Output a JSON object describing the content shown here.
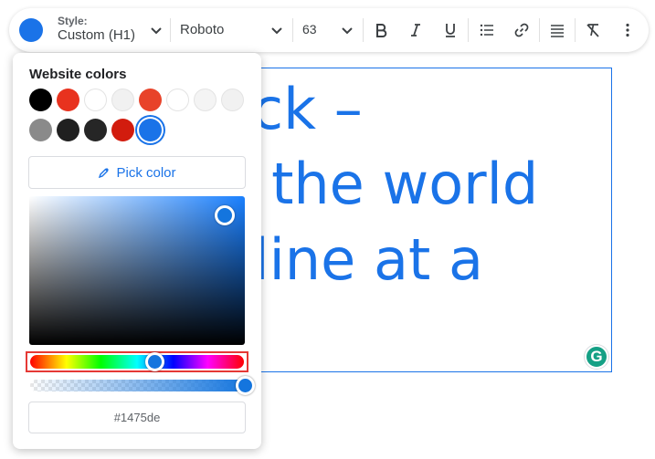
{
  "toolbar": {
    "current_color": "#1a73e8",
    "style_label": "Style:",
    "style_value": "Custom (H1)",
    "font_family": "Roboto",
    "font_size": "63",
    "buttons": [
      "bold-icon",
      "italic-icon",
      "underline-icon",
      "bulleted-list-icon",
      "link-icon",
      "align-icon",
      "clear-formatting-icon",
      "more-vertical-icon"
    ]
  },
  "editor": {
    "lines": [
      "ack –",
      "g the world",
      "dline at a"
    ],
    "text_color": "#1a73e8",
    "grammarly_letter": "G"
  },
  "picker": {
    "title": "Website colors",
    "swatches": [
      {
        "color": "#000000"
      },
      {
        "color": "#e8321e"
      },
      {
        "color": "#ffffff"
      },
      {
        "color": "#f1f1f1"
      },
      {
        "color": "#e8432a"
      },
      {
        "color": "#ffffff"
      },
      {
        "color": "#f4f4f4"
      },
      {
        "color": "#f1f1f1"
      },
      {
        "color": "#8a8a8a"
      },
      {
        "color": "#202020"
      },
      {
        "color": "#262626"
      },
      {
        "color": "#d21c0e"
      },
      {
        "color": "#1a73e8",
        "selected": true
      }
    ],
    "pick_color_label": "Pick color",
    "hex_value": "#1475de",
    "hue_base": "#1a80ff",
    "alpha_percent": 100,
    "hue_highlight_color": "#e53935"
  }
}
